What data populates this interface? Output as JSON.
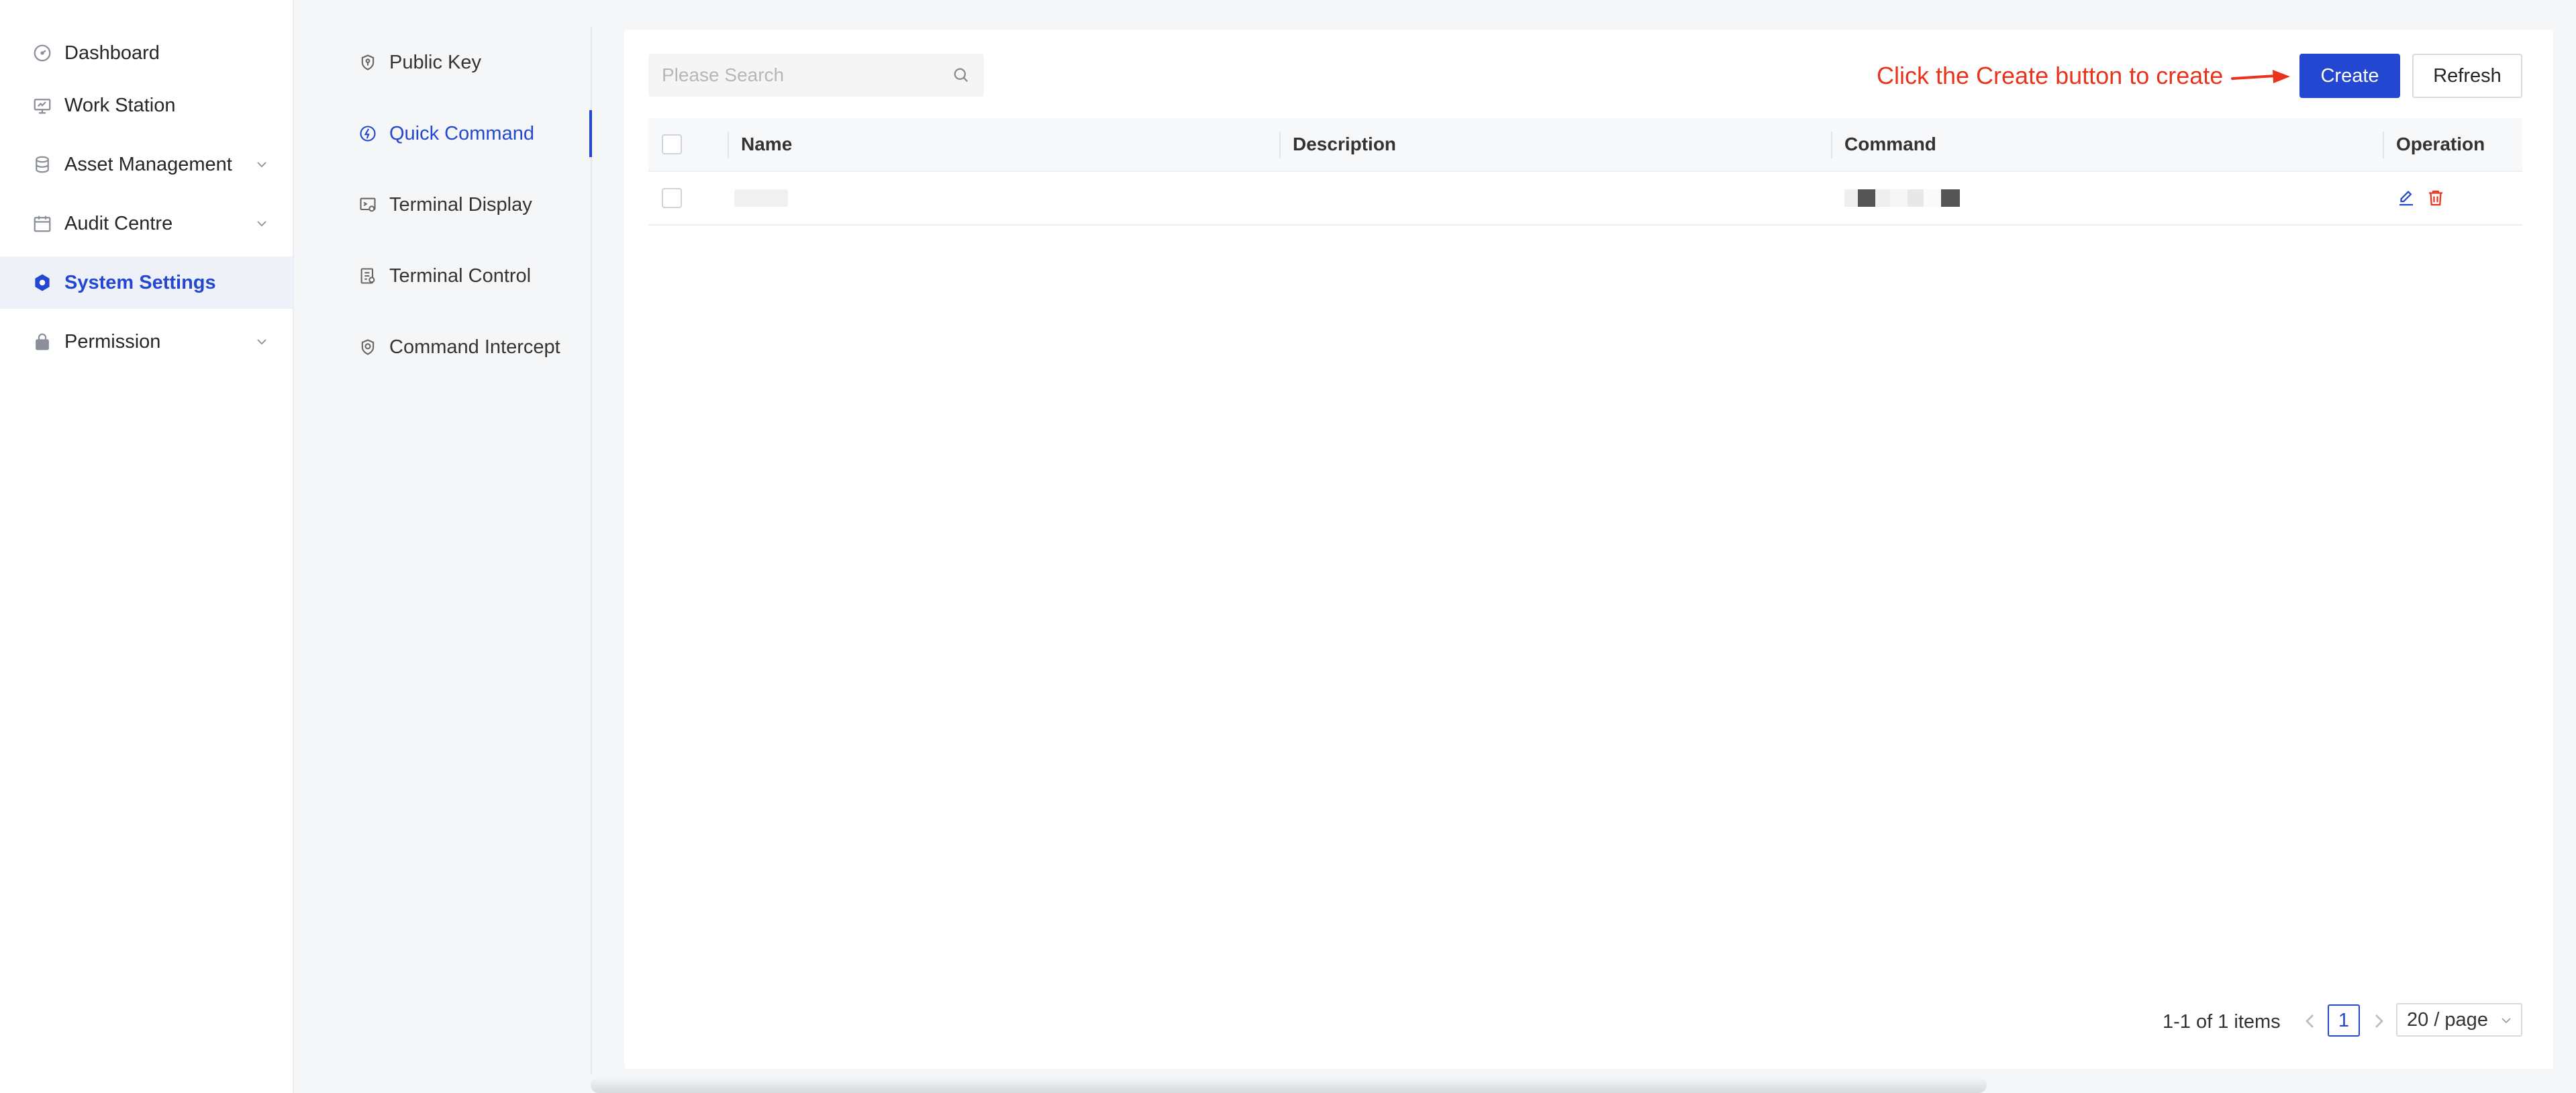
{
  "sidebar": {
    "items": [
      {
        "label": "Dashboard",
        "icon": "gauge-icon"
      },
      {
        "label": "Work Station",
        "icon": "monitor-icon"
      },
      {
        "label": "Asset Management",
        "icon": "database-icon",
        "expandable": true
      },
      {
        "label": "Audit Centre",
        "icon": "calendar-icon",
        "expandable": true
      },
      {
        "label": "System Settings",
        "icon": "gear-icon",
        "active": true
      },
      {
        "label": "Permission",
        "icon": "lock-icon",
        "expandable": true
      }
    ]
  },
  "submenu": {
    "items": [
      {
        "label": "Public Key",
        "icon": "shield-key-icon"
      },
      {
        "label": "Quick Command",
        "icon": "quick-command-icon",
        "active": true
      },
      {
        "label": "Terminal Display",
        "icon": "terminal-display-icon"
      },
      {
        "label": "Terminal Control",
        "icon": "terminal-control-icon"
      },
      {
        "label": "Command Intercept",
        "icon": "shield-check-icon"
      }
    ]
  },
  "toolbar": {
    "search_placeholder": "Please Search",
    "hint": "Click the Create button to create",
    "create_label": "Create",
    "refresh_label": "Refresh"
  },
  "table": {
    "columns": [
      "Name",
      "Description",
      "Command",
      "Operation"
    ],
    "rows": [
      {
        "name": "",
        "description": "",
        "command": ""
      }
    ]
  },
  "pagination": {
    "total_text": "1-1 of 1 items",
    "current_page": "1",
    "page_size": "20 / page"
  },
  "colors": {
    "accent": "#2347d1",
    "hint": "#e8341c",
    "delete": "#e8341c"
  }
}
